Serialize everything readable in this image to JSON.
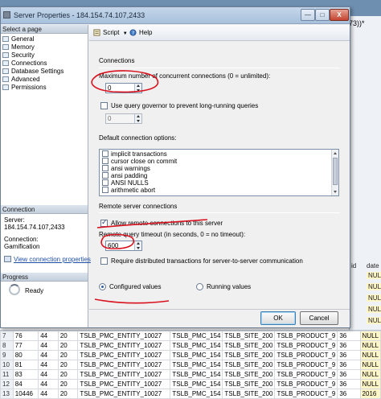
{
  "background": {
    "title_suffix": "(73))*",
    "column_headers": [
      "id",
      "date"
    ],
    "null_text": "NULL",
    "side_values_text": "2016",
    "rows": [
      [
        "7",
        "76",
        "44",
        "20",
        "TSLB_PMC_ENTITY_10027",
        "TSLB_PMC_154",
        "TSLB_SITE_200",
        "TSLB_PRODUCT_9",
        "36"
      ],
      [
        "8",
        "77",
        "44",
        "20",
        "TSLB_PMC_ENTITY_10027",
        "TSLB_PMC_154",
        "TSLB_SITE_200",
        "TSLB_PRODUCT_9",
        "36"
      ],
      [
        "9",
        "80",
        "44",
        "20",
        "TSLB_PMC_ENTITY_10027",
        "TSLB_PMC_154",
        "TSLB_SITE_200",
        "TSLB_PRODUCT_9",
        "36"
      ],
      [
        "10",
        "81",
        "44",
        "20",
        "TSLB_PMC_ENTITY_10027",
        "TSLB_PMC_154",
        "TSLB_SITE_200",
        "TSLB_PRODUCT_9",
        "36"
      ],
      [
        "11",
        "83",
        "44",
        "20",
        "TSLB_PMC_ENTITY_10027",
        "TSLB_PMC_154",
        "TSLB_SITE_200",
        "TSLB_PRODUCT_9",
        "36"
      ],
      [
        "12",
        "84",
        "44",
        "20",
        "TSLB_PMC_ENTITY_10027",
        "TSLB_PMC_154",
        "TSLB_SITE_200",
        "TSLB_PRODUCT_9",
        "36"
      ],
      [
        "13",
        "10446",
        "44",
        "20",
        "TSLB_PMC_ENTITY_10027",
        "TSLB_PMC_154",
        "TSLB_SITE_200",
        "TSLB_PRODUCT_9",
        "36"
      ]
    ]
  },
  "dialog": {
    "title": "Server Properties - 184.154.74.107,2433",
    "buttons": {
      "minimize": "—",
      "maximize": "□",
      "close": "X"
    },
    "left": {
      "select_page_header": "Select a page",
      "pages": [
        "General",
        "Memory",
        "Security",
        "Connections",
        "Database Settings",
        "Advanced",
        "Permissions"
      ],
      "connection_header": "Connection",
      "server_label": "Server:",
      "server_value": "184.154.74.107,2433",
      "connection_label": "Connection:",
      "connection_value": "Gamification",
      "view_connection_link": "View connection properties",
      "progress_header": "Progress",
      "progress_status": "Ready"
    },
    "toolbar": {
      "script_label": "Script",
      "help_label": "Help"
    },
    "main": {
      "connections_heading": "Connections",
      "max_conn_label": "Maximum number of concurrent connections (0 = unlimited):",
      "max_conn_value": "0",
      "query_governor_label": "Use query governor to prevent long-running queries",
      "query_governor_value": "0",
      "default_options_label": "Default connection options:",
      "options": [
        "implicit transactions",
        "cursor close on commit",
        "ansi warnings",
        "ansi padding",
        "ANSI NULLS",
        "arithmetic abort"
      ],
      "remote_heading": "Remote server connections",
      "allow_remote_label": "Allow remote connections to this server",
      "remote_timeout_label": "Remote query timeout (in seconds, 0 = no timeout):",
      "remote_timeout_value": "600",
      "require_distributed_label": "Require distributed transactions for server-to-server communication",
      "configured_label": "Configured values",
      "running_label": "Running values"
    },
    "footer": {
      "ok_label": "OK",
      "cancel_label": "Cancel"
    }
  },
  "colors": {
    "annotation": "#d9121f",
    "link": "#1f4fa8",
    "titlebar": "#b5cbe2"
  }
}
